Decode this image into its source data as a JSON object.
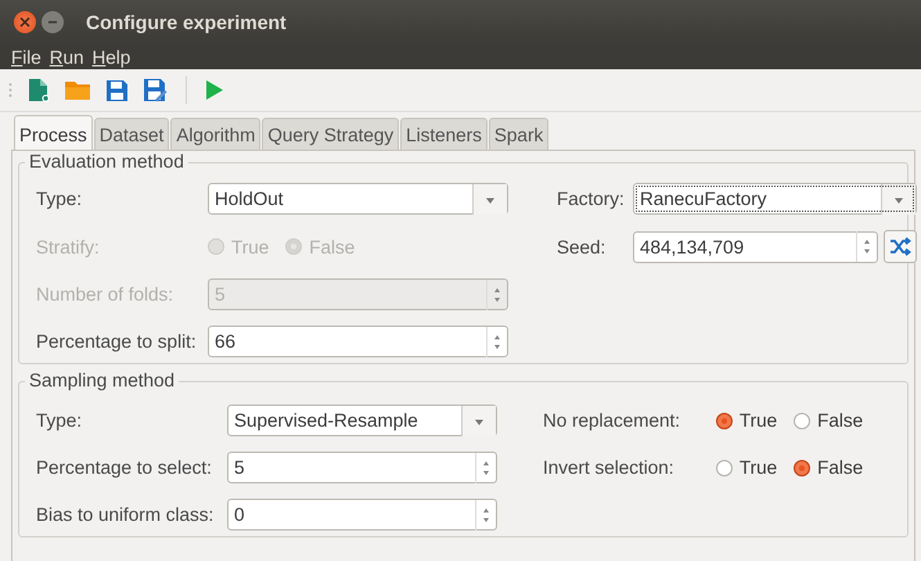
{
  "window": {
    "title": "Configure experiment"
  },
  "menu": [
    {
      "label": "File"
    },
    {
      "label": "Run"
    },
    {
      "label": "Help"
    }
  ],
  "tabs": [
    {
      "label": "Process",
      "selected": true
    },
    {
      "label": "Dataset",
      "selected": false
    },
    {
      "label": "Algorithm",
      "selected": false
    },
    {
      "label": "Query Strategy",
      "selected": false
    },
    {
      "label": "Listeners",
      "selected": false
    },
    {
      "label": "Spark",
      "selected": false
    }
  ],
  "sections": [
    {
      "legend": "Evaluation method",
      "left": [
        {
          "kind": "combo",
          "label": "Type:",
          "value": "HoldOut",
          "disabled": false
        },
        {
          "kind": "radios",
          "label": "Stratify:",
          "disabled": true,
          "options": [
            {
              "label": "True",
              "selected": false
            },
            {
              "label": "False",
              "selected": true
            }
          ]
        },
        {
          "kind": "spin",
          "label": "Number of folds:",
          "value": "5",
          "disabled": true
        },
        {
          "kind": "spin",
          "label": "Percentage to split:",
          "value": "66",
          "disabled": false
        }
      ],
      "right": [
        {
          "kind": "combo",
          "label": "Factory:",
          "value": "RanecuFactory",
          "disabled": false,
          "focused": true
        },
        {
          "kind": "spin-shuffle",
          "label": "Seed:",
          "value": "484,134,709",
          "disabled": false
        }
      ]
    },
    {
      "legend": "Sampling method",
      "left": [
        {
          "kind": "combo",
          "label": "Type:",
          "value": "Supervised-Resample",
          "disabled": false
        },
        {
          "kind": "spin",
          "label": "Percentage to select:",
          "value": "5",
          "disabled": false
        },
        {
          "kind": "spin",
          "label": "Bias to uniform class:",
          "value": "0",
          "disabled": false
        }
      ],
      "right": [
        {
          "kind": "radios",
          "label": "No replacement:",
          "disabled": false,
          "options": [
            {
              "label": "True",
              "selected": true
            },
            {
              "label": "False",
              "selected": false
            }
          ]
        },
        {
          "kind": "radios",
          "label": "Invert selection:",
          "disabled": false,
          "options": [
            {
              "label": "True",
              "selected": false
            },
            {
              "label": "False",
              "selected": true
            }
          ]
        }
      ]
    }
  ]
}
